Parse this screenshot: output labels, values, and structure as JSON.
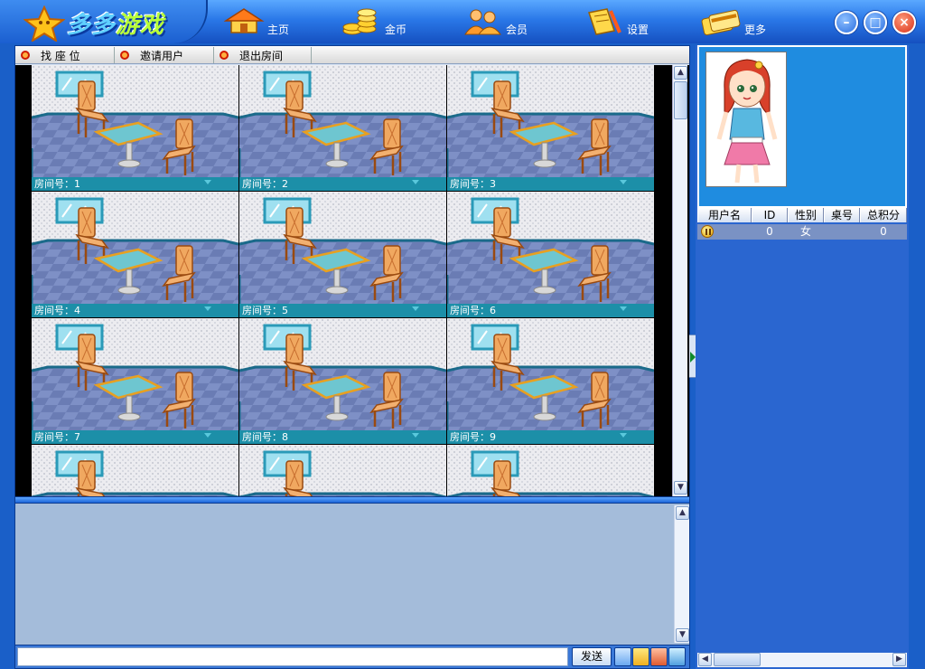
{
  "app": {
    "logo_part1": "多多",
    "logo_part2": "游戏"
  },
  "nav": [
    {
      "label": "主页",
      "icon": "home-icon"
    },
    {
      "label": "金币",
      "icon": "coins-icon"
    },
    {
      "label": "会员",
      "icon": "members-icon"
    },
    {
      "label": "设置",
      "icon": "settings-icon"
    },
    {
      "label": "更多",
      "icon": "more-icon"
    }
  ],
  "window_controls": {
    "minimize": "–",
    "maximize": "□",
    "close": "×"
  },
  "toolbar": [
    {
      "label": "找 座 位"
    },
    {
      "label": "邀请用户"
    },
    {
      "label": "退出房间"
    }
  ],
  "rooms": [
    {
      "caption": "房间号：1"
    },
    {
      "caption": "房间号：2"
    },
    {
      "caption": "房间号：3"
    },
    {
      "caption": "房间号：4"
    },
    {
      "caption": "房间号：5"
    },
    {
      "caption": "房间号：6"
    },
    {
      "caption": "房间号：7"
    },
    {
      "caption": "房间号：8"
    },
    {
      "caption": "房间号：9"
    },
    {
      "caption": ""
    },
    {
      "caption": ""
    },
    {
      "caption": ""
    }
  ],
  "chat": {
    "input_value": "",
    "send_label": "发送"
  },
  "user_list": {
    "columns": [
      "用户名",
      "ID",
      "性别",
      "桌号",
      "总积分"
    ],
    "rows": [
      {
        "name": "",
        "id": "0",
        "gender": "女",
        "table": "",
        "score": "0"
      }
    ]
  },
  "colors": {
    "titlebar": "#2a78e8",
    "room_caption": "#1c8fa8",
    "chat_bg": "#a4bcda",
    "user_panel": "#2a66d0"
  }
}
